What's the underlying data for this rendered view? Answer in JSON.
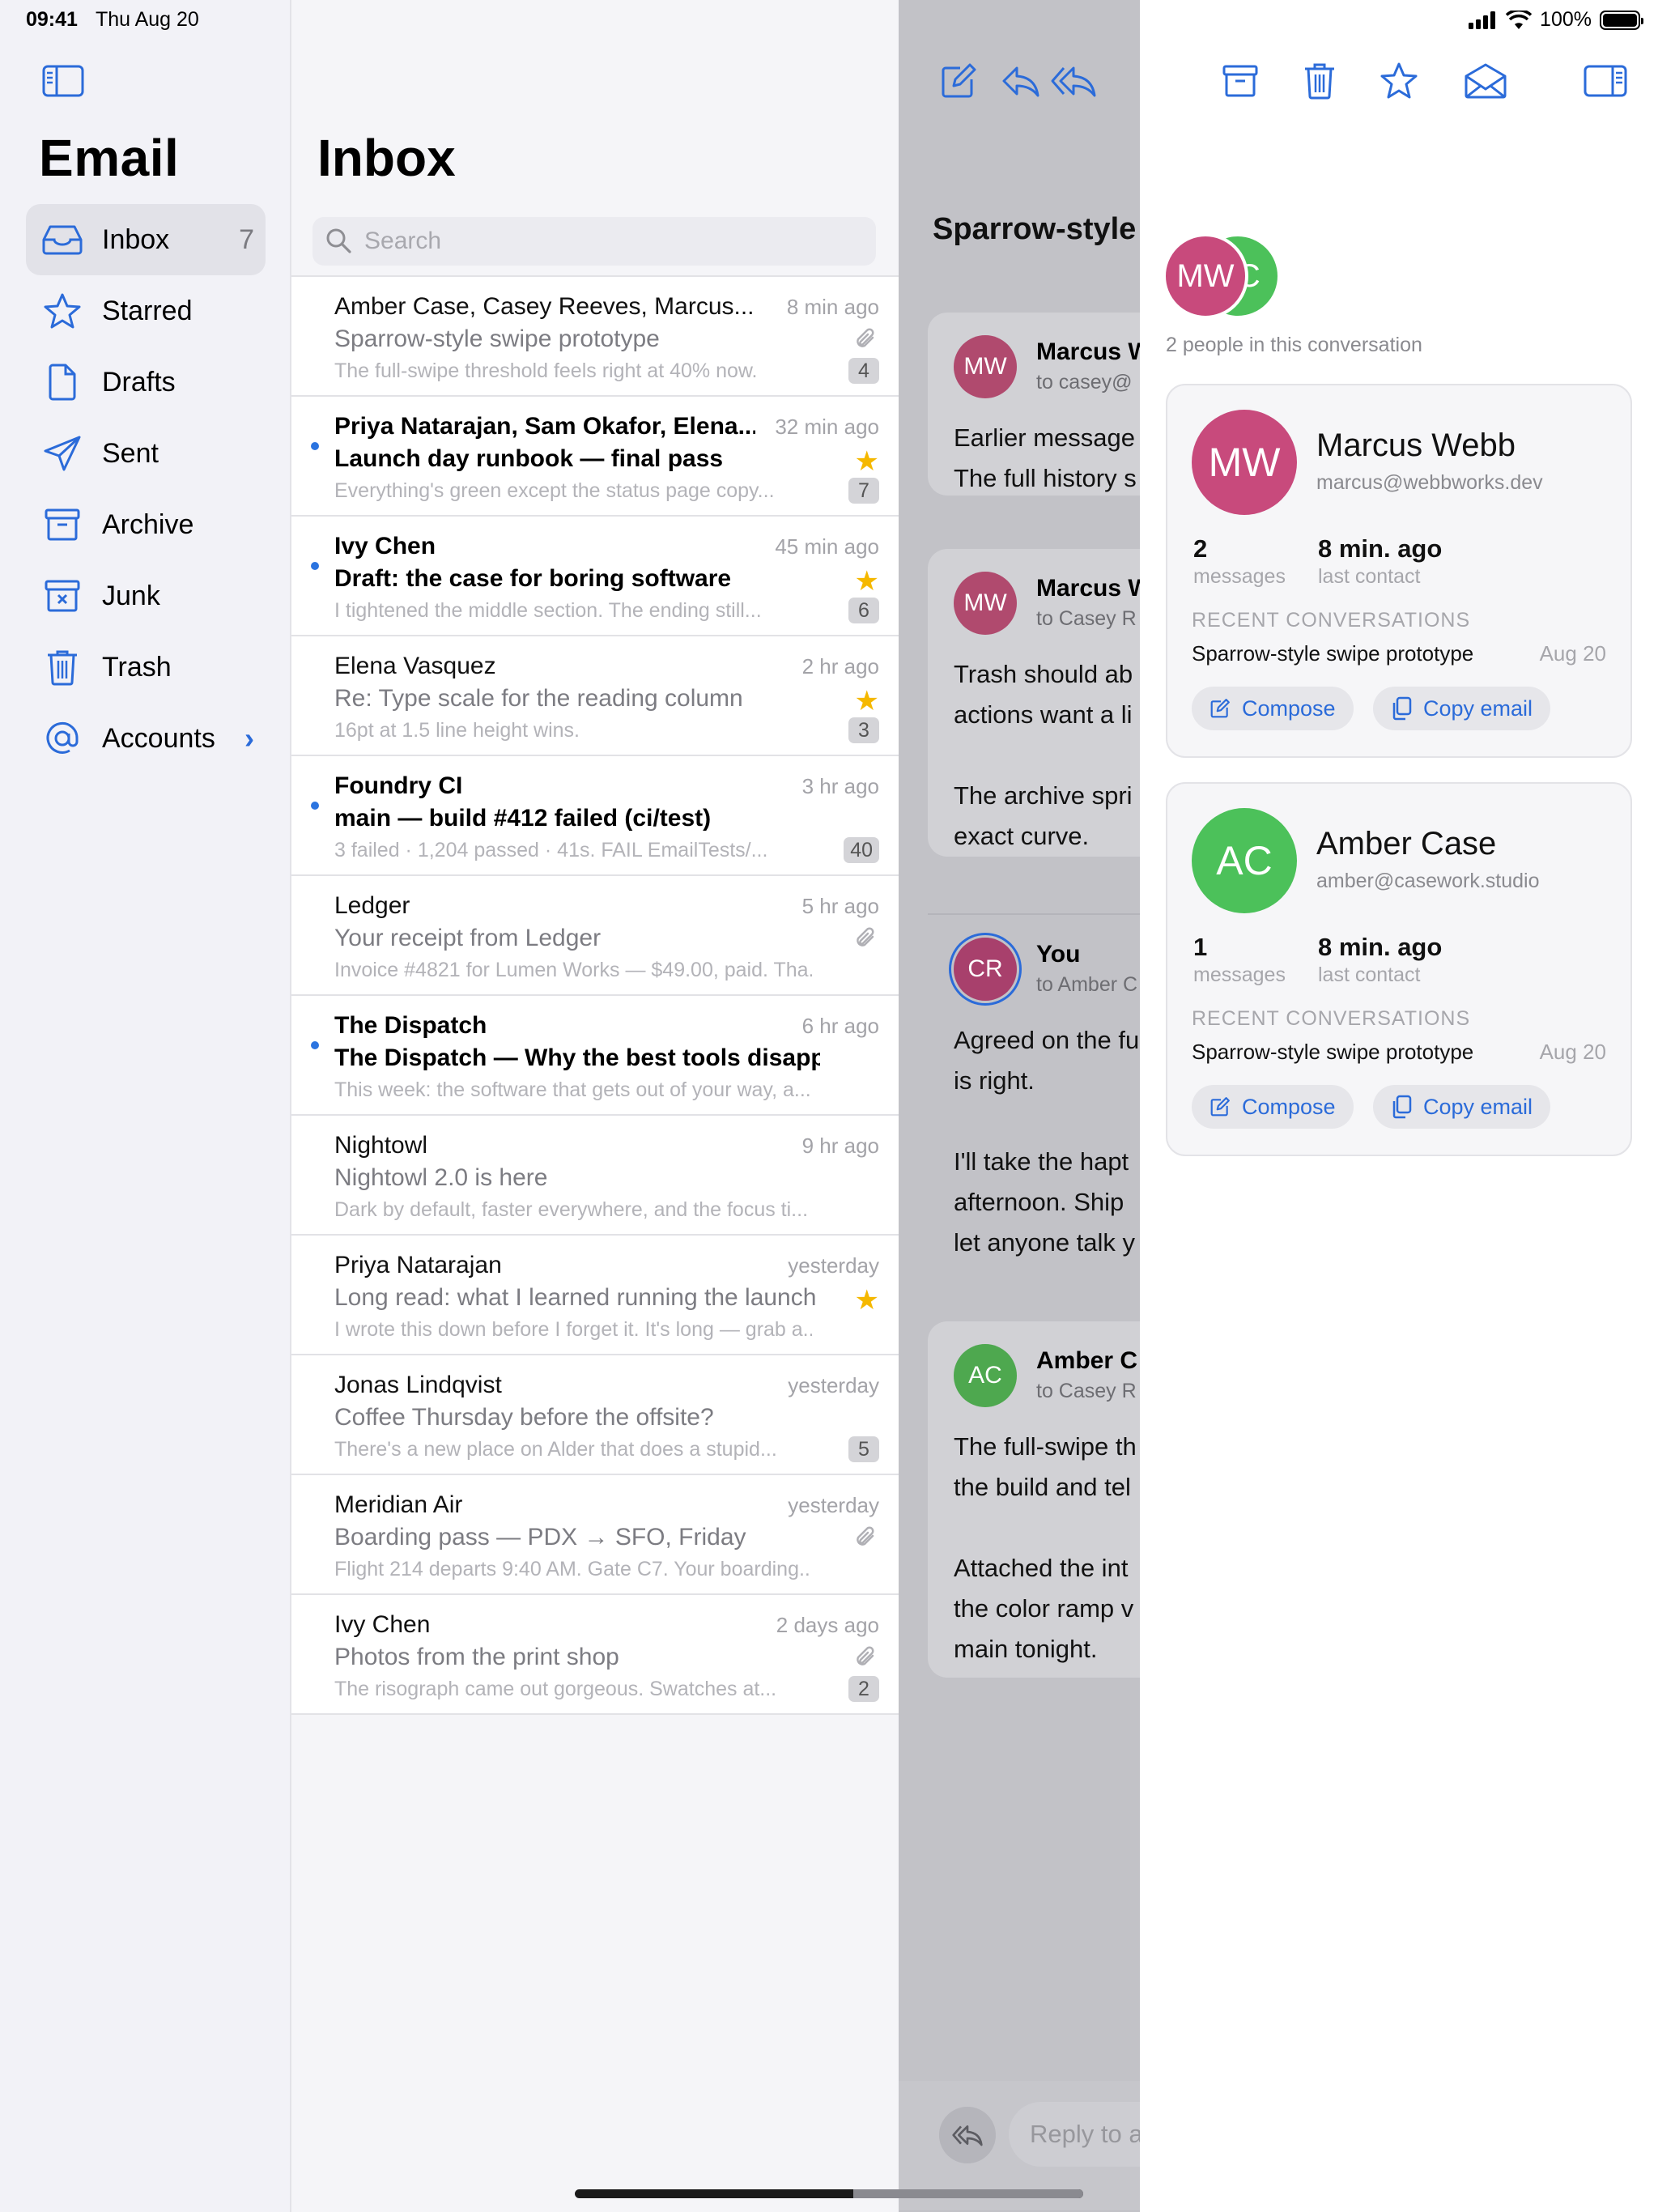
{
  "status": {
    "time": "09:41",
    "date": "Thu Aug 20",
    "battery": "100%"
  },
  "sidebar": {
    "title": "Email",
    "items": [
      {
        "label": "Inbox",
        "count": "7",
        "icon": "inbox-icon"
      },
      {
        "label": "Starred",
        "icon": "star-icon"
      },
      {
        "label": "Drafts",
        "icon": "document-icon"
      },
      {
        "label": "Sent",
        "icon": "paper-plane-icon"
      },
      {
        "label": "Archive",
        "icon": "archive-box-icon"
      },
      {
        "label": "Junk",
        "icon": "junk-box-icon"
      },
      {
        "label": "Trash",
        "icon": "trash-icon"
      },
      {
        "label": "Accounts",
        "icon": "at-sign-icon"
      }
    ]
  },
  "inbox": {
    "title": "Inbox",
    "search_placeholder": "Search",
    "messages": [
      {
        "sender": "Amber Case, Casey Reeves, Marcus...",
        "time": "8 min ago",
        "subject": "Sparrow-style swipe prototype",
        "preview": "The full-swipe threshold feels right at 40% now.",
        "count": "4",
        "unread": false,
        "starred": false,
        "attachment": true
      },
      {
        "sender": "Priya Natarajan, Sam Okafor, Elena...",
        "time": "32 min ago",
        "subject": "Launch day runbook — final pass",
        "preview": "Everything's green except the status page copy...",
        "count": "7",
        "unread": true,
        "starred": true,
        "attachment": false
      },
      {
        "sender": "Ivy Chen",
        "time": "45 min ago",
        "subject": "Draft: the case for boring software",
        "preview": "I tightened the middle section. The ending still...",
        "count": "6",
        "unread": true,
        "starred": true,
        "attachment": false
      },
      {
        "sender": "Elena Vasquez",
        "time": "2 hr ago",
        "subject": "Re: Type scale for the reading column",
        "preview": "16pt at 1.5 line height wins.",
        "count": "3",
        "unread": false,
        "starred": true,
        "attachment": false
      },
      {
        "sender": "Foundry CI",
        "time": "3 hr ago",
        "subject": "main — build #412 failed (ci/test)",
        "preview": "3 failed · 1,204 passed · 41s. FAIL EmailTests/...",
        "count": "40",
        "unread": true,
        "starred": false,
        "attachment": false
      },
      {
        "sender": "Ledger",
        "time": "5 hr ago",
        "subject": "Your receipt from Ledger",
        "preview": "Invoice #4821 for Lumen Works — $49.00, paid. Tha...",
        "count": "",
        "unread": false,
        "starred": false,
        "attachment": true
      },
      {
        "sender": "The Dispatch",
        "time": "6 hr ago",
        "subject": "The Dispatch — Why the best tools disappear",
        "preview": "This week: the software that gets out of your way, a...",
        "count": "",
        "unread": true,
        "starred": false,
        "attachment": false
      },
      {
        "sender": "Nightowl",
        "time": "9 hr ago",
        "subject": "Nightowl 2.0 is here",
        "preview": "Dark by default, faster everywhere, and the focus ti...",
        "count": "",
        "unread": false,
        "starred": false,
        "attachment": false
      },
      {
        "sender": "Priya Natarajan",
        "time": "yesterday",
        "subject": "Long read: what I learned running the launch",
        "preview": "I wrote this down before I forget it. It's long — grab a...",
        "count": "",
        "unread": false,
        "starred": true,
        "attachment": false
      },
      {
        "sender": "Jonas Lindqvist",
        "time": "yesterday",
        "subject": "Coffee Thursday before the offsite?",
        "preview": "There's a new place on Alder that does a stupid...",
        "count": "5",
        "unread": false,
        "starred": false,
        "attachment": false
      },
      {
        "sender": "Meridian Air",
        "time": "yesterday",
        "subject": "Boarding pass — PDX → SFO, Friday",
        "preview": "Flight 214 departs 9:40 AM. Gate C7. Your boarding...",
        "count": "",
        "unread": false,
        "starred": false,
        "attachment": true
      },
      {
        "sender": "Ivy Chen",
        "time": "2 days ago",
        "subject": "Photos from the print shop",
        "preview": "The risograph came out gorgeous. Swatches at...",
        "count": "2",
        "unread": false,
        "starred": false,
        "attachment": true
      }
    ]
  },
  "detail": {
    "title": "Sparrow-style",
    "messages": [
      {
        "initials": "MW",
        "name": "Marcus W",
        "to": "to casey@",
        "body": "Earlier message\nThe full history s",
        "color": "#b04a6e"
      },
      {
        "initials": "MW",
        "name": "Marcus W",
        "to": "to Casey R",
        "body": "Trash should ab\nactions want a li\n\nThe archive spri\nexact curve.",
        "color": "#b04a6e"
      },
      {
        "initials": "CR",
        "name": "You",
        "to": "to Amber C",
        "body": "Agreed on the fu\nis right.\n\nI'll take the hapt\nafternoon. Ship\nlet anyone talk y",
        "color": "#a8406c"
      },
      {
        "initials": "AC",
        "name": "Amber C",
        "to": "to Casey R",
        "body": "The full-swipe th\nthe build and tel\n\nAttached the int\nthe color ramp v\nmain tonight.",
        "color": "#4ea84f"
      }
    ],
    "reply_placeholder": "Reply to a"
  },
  "panel": {
    "avatars": [
      {
        "initials": "MW",
        "color": "#c84a7c"
      },
      {
        "initials": "AC",
        "color": "#4cc15a"
      }
    ],
    "people_count": "2 people in this conversation",
    "contacts": [
      {
        "initials": "MW",
        "name": "Marcus Webb",
        "email": "marcus@webbworks.dev",
        "messages_count": "2",
        "messages_label": "messages",
        "last_contact": "8 min. ago",
        "last_contact_label": "last contact",
        "recent_heading": "RECENT CONVERSATIONS",
        "recent_title": "Sparrow-style swipe prototype",
        "recent_date": "Aug 20",
        "compose": "Compose",
        "copy": "Copy email",
        "color": "#c84a7c"
      },
      {
        "initials": "AC",
        "name": "Amber Case",
        "email": "amber@casework.studio",
        "messages_count": "1",
        "messages_label": "messages",
        "last_contact": "8 min. ago",
        "last_contact_label": "last contact",
        "recent_heading": "RECENT CONVERSATIONS",
        "recent_title": "Sparrow-style swipe prototype",
        "recent_date": "Aug 20",
        "compose": "Compose",
        "copy": "Copy email",
        "color": "#4cc15a"
      }
    ]
  },
  "colors": {
    "accent": "#2b6bd9",
    "star": "#f5b800",
    "unread_dot": "#2b74e0"
  }
}
